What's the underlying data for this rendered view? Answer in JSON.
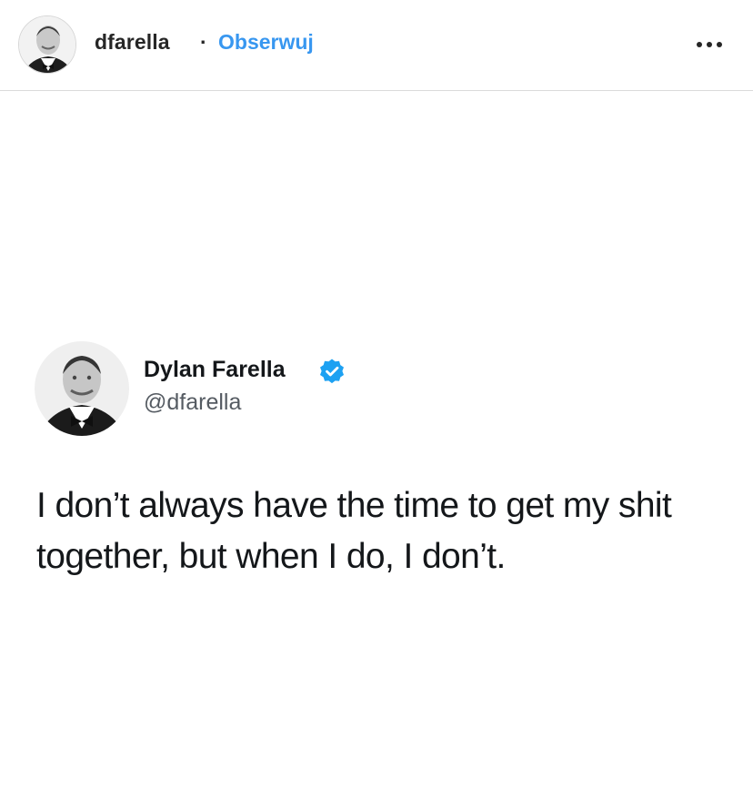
{
  "post_header": {
    "username": "dfarella",
    "separator": "·",
    "follow_label": "Obserwuj",
    "more_icon": "more-horizontal-icon",
    "follow_color": "#3897f0"
  },
  "tweet": {
    "display_name": "Dylan Farella",
    "verified_icon": "verified-badge-icon",
    "verified_color": "#1da1f2",
    "handle": "@dfarella",
    "text": "I don’t always have the time to get my shit together, but when I do, I don’t."
  }
}
